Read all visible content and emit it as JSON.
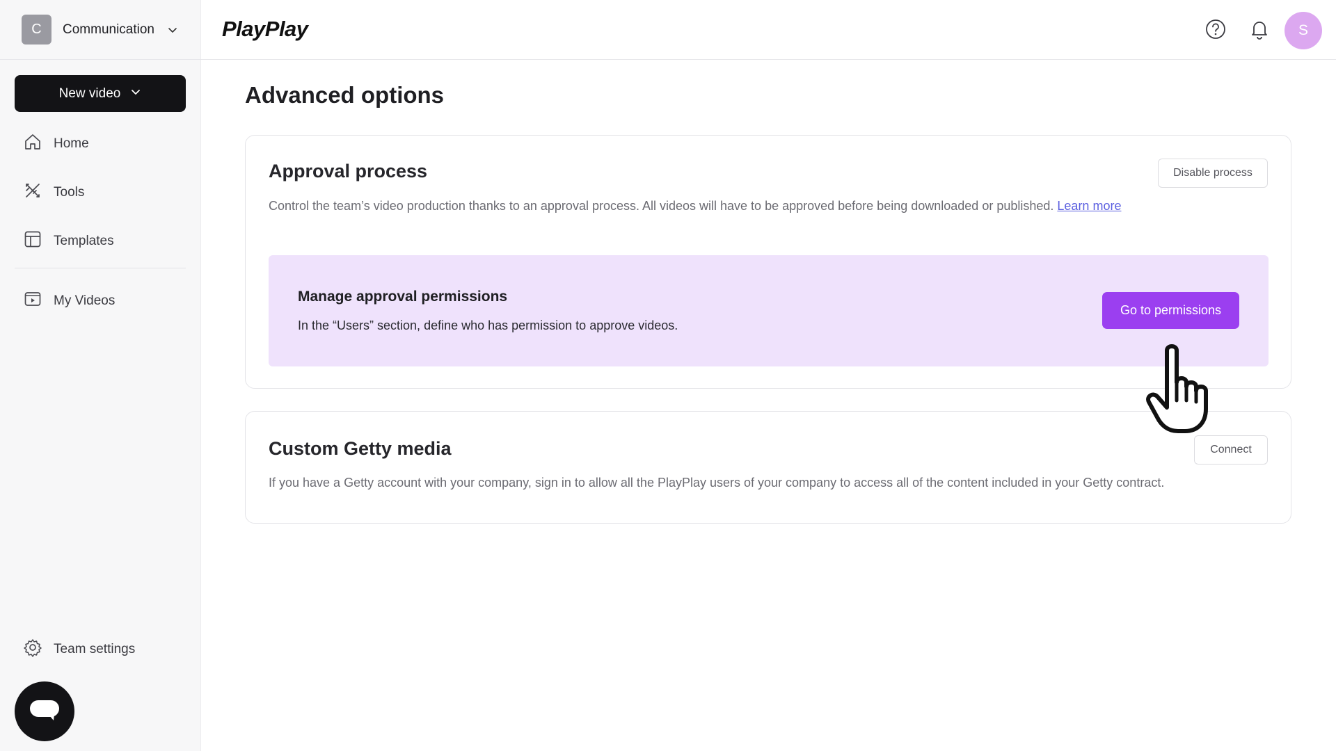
{
  "workspace": {
    "initial": "C",
    "name": "Communication"
  },
  "new_video": {
    "label": "New video"
  },
  "nav": {
    "home": "Home",
    "tools": "Tools",
    "templates": "Templates",
    "my_videos": "My Videos",
    "team_settings": "Team settings"
  },
  "header": {
    "logo": "PlayPlay",
    "user_initial": "S"
  },
  "page": {
    "title": "Advanced options"
  },
  "approval": {
    "title": "Approval process",
    "description": "Control the team’s video production thanks to an approval process. All videos will have to be approved before being downloaded or published.",
    "learn_more": "Learn more",
    "disable_button": "Disable process",
    "permissions": {
      "title": "Manage approval permissions",
      "description": "In the “Users” section, define who has permission to approve videos.",
      "button": "Go to permissions"
    }
  },
  "getty": {
    "title": "Custom Getty media",
    "description": "If you have a Getty account with your company, sign in to allow all the PlayPlay users of your company to access all of the content included in your Getty contract.",
    "connect_button": "Connect"
  },
  "colors": {
    "accent": "#9b3ff0",
    "permissions_bg": "#efe2fc",
    "sidebar_bg": "#f7f7f8",
    "primary_dark": "#131316",
    "avatar": "#dca8f0",
    "link": "#5b5fe0"
  },
  "icons": [
    "chevron-down-icon",
    "home-icon",
    "tools-icon",
    "templates-icon",
    "video-icon",
    "help-icon",
    "bell-icon",
    "gear-icon",
    "chat-icon",
    "hand-cursor-icon"
  ]
}
